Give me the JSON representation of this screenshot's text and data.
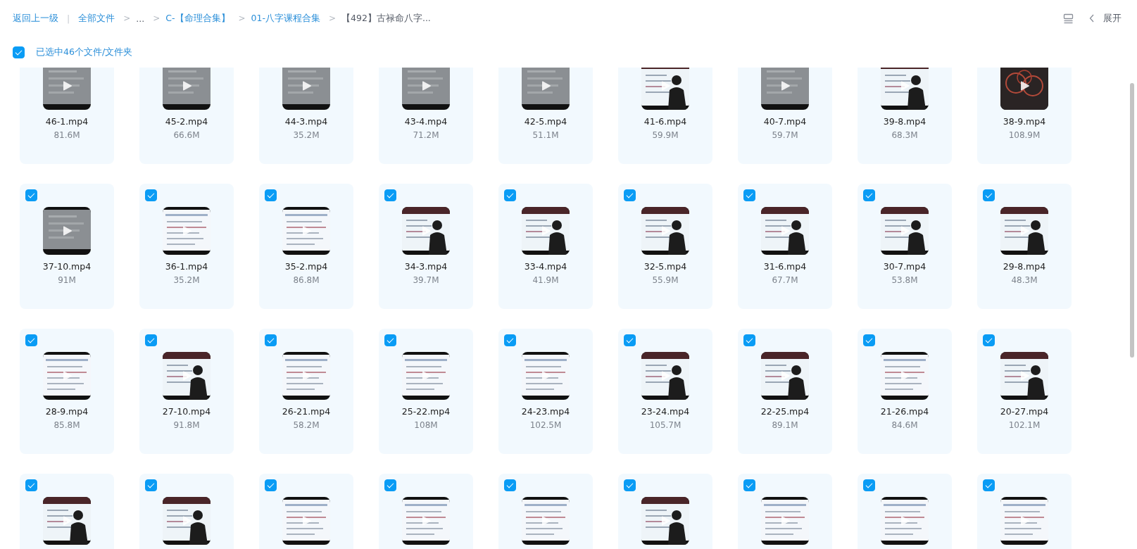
{
  "breadcrumb": {
    "back": "返回上一级",
    "separator": "|",
    "items": [
      {
        "label": "全部文件",
        "kind": "link"
      },
      {
        "label": "...",
        "kind": "ellipsis"
      },
      {
        "label": "C-【命理合集】",
        "kind": "link"
      },
      {
        "label": "01-八字课程合集",
        "kind": "link"
      },
      {
        "label": "【492】古禄命八字...",
        "kind": "current"
      }
    ],
    "arrow": ">"
  },
  "toolbar": {
    "expand_label": "展开"
  },
  "selection": {
    "label": "已选中46个文件/文件夹",
    "checked": true
  },
  "files": [
    {
      "name": "46-1.mp4",
      "size": "81.6M"
    },
    {
      "name": "45-2.mp4",
      "size": "66.6M"
    },
    {
      "name": "44-3.mp4",
      "size": "35.2M"
    },
    {
      "name": "43-4.mp4",
      "size": "71.2M"
    },
    {
      "name": "42-5.mp4",
      "size": "51.1M"
    },
    {
      "name": "41-6.mp4",
      "size": "59.9M"
    },
    {
      "name": "40-7.mp4",
      "size": "59.7M"
    },
    {
      "name": "39-8.mp4",
      "size": "68.3M"
    },
    {
      "name": "38-9.mp4",
      "size": "108.9M"
    },
    {
      "name": "37-10.mp4",
      "size": "91M",
      "selected": true
    },
    {
      "name": "36-1.mp4",
      "size": "35.2M",
      "selected": true
    },
    {
      "name": "35-2.mp4",
      "size": "86.8M",
      "selected": true
    },
    {
      "name": "34-3.mp4",
      "size": "39.7M",
      "selected": true
    },
    {
      "name": "33-4.mp4",
      "size": "41.9M",
      "selected": true
    },
    {
      "name": "32-5.mp4",
      "size": "55.9M",
      "selected": true
    },
    {
      "name": "31-6.mp4",
      "size": "67.7M",
      "selected": true
    },
    {
      "name": "30-7.mp4",
      "size": "53.8M",
      "selected": true
    },
    {
      "name": "29-8.mp4",
      "size": "48.3M",
      "selected": true
    },
    {
      "name": "28-9.mp4",
      "size": "85.8M",
      "selected": true
    },
    {
      "name": "27-10.mp4",
      "size": "91.8M",
      "selected": true
    },
    {
      "name": "26-21.mp4",
      "size": "58.2M",
      "selected": true
    },
    {
      "name": "25-22.mp4",
      "size": "108M",
      "selected": true
    },
    {
      "name": "24-23.mp4",
      "size": "102.5M",
      "selected": true
    },
    {
      "name": "23-24.mp4",
      "size": "105.7M",
      "selected": true
    },
    {
      "name": "22-25.mp4",
      "size": "89.1M",
      "selected": true
    },
    {
      "name": "21-26.mp4",
      "size": "84.6M",
      "selected": true
    },
    {
      "name": "20-27.mp4",
      "size": "102.1M",
      "selected": true
    },
    {
      "selected": true
    },
    {
      "selected": true
    },
    {
      "selected": true
    },
    {
      "selected": true
    },
    {
      "selected": true
    },
    {
      "selected": true
    },
    {
      "selected": true
    },
    {
      "selected": true
    },
    {
      "selected": true
    }
  ]
}
